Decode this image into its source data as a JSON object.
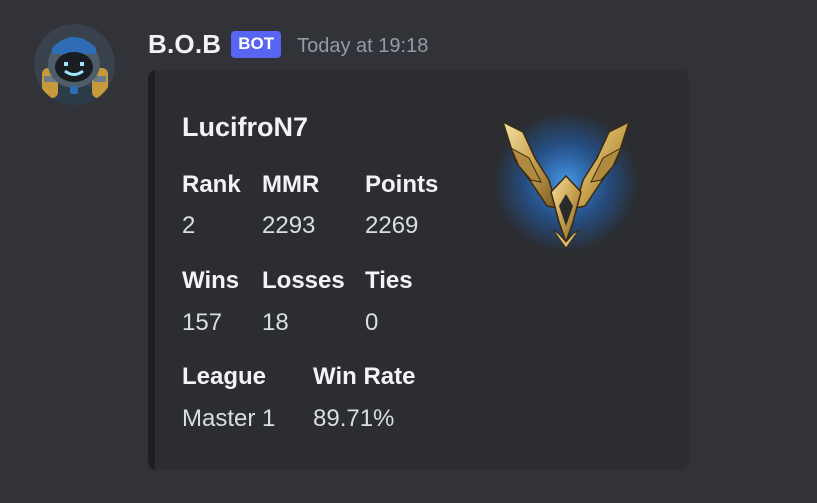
{
  "message": {
    "username": "B.O.B",
    "bot_tag": "BOT",
    "timestamp": "Today at 19:18"
  },
  "embed": {
    "title": "LucifroN7",
    "fields": {
      "rank": {
        "name": "Rank",
        "value": "2"
      },
      "mmr": {
        "name": "MMR",
        "value": "2293"
      },
      "points": {
        "name": "Points",
        "value": "2269"
      },
      "wins": {
        "name": "Wins",
        "value": "157"
      },
      "losses": {
        "name": "Losses",
        "value": "18"
      },
      "ties": {
        "name": "Ties",
        "value": "0"
      },
      "league": {
        "name": "League",
        "value": "Master 1"
      },
      "win_rate": {
        "name": "Win Rate",
        "value": "89.71%"
      }
    },
    "thumbnail_icon": "master-league-wings-emblem-icon",
    "accent_color": "#1e1f22"
  },
  "colors": {
    "background": "#313338",
    "embed_background": "#2b2d31",
    "bot_tag": "#5865f2",
    "timestamp": "#949ba4"
  }
}
